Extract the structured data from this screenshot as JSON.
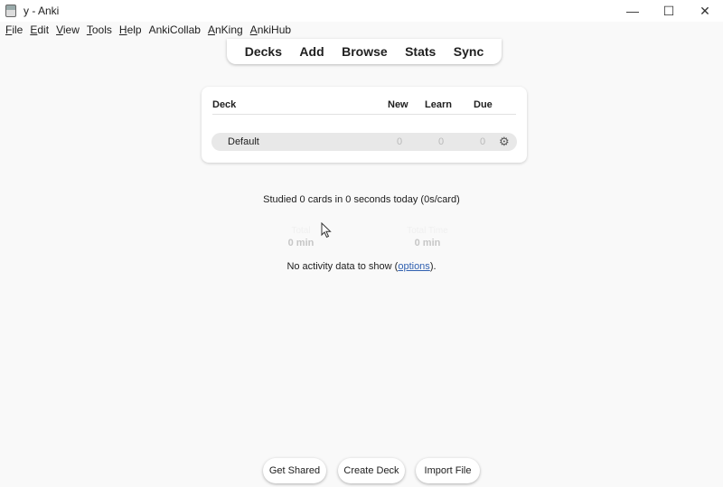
{
  "window": {
    "title": "y - Anki",
    "controls": {
      "minimize": "—",
      "maximize": "☐",
      "close": "✕"
    }
  },
  "menubar": {
    "items": [
      {
        "first": "F",
        "rest": "ile"
      },
      {
        "first": "E",
        "rest": "dit"
      },
      {
        "first": "V",
        "rest": "iew"
      },
      {
        "first": "T",
        "rest": "ools"
      },
      {
        "first": "H",
        "rest": "elp"
      },
      {
        "first": "",
        "rest": "AnkiCollab"
      },
      {
        "first": "A",
        "rest": "nKing"
      },
      {
        "first": "A",
        "rest": "nkiHub"
      }
    ]
  },
  "toolbar": {
    "decks": "Decks",
    "add": "Add",
    "browse": "Browse",
    "stats": "Stats",
    "sync": "Sync"
  },
  "deck_table": {
    "headers": {
      "deck": "Deck",
      "new": "New",
      "learn": "Learn",
      "due": "Due"
    },
    "rows": [
      {
        "name": "Default",
        "new": "0",
        "learn": "0",
        "due": "0"
      }
    ]
  },
  "stats": {
    "studied": "Studied 0 cards in 0 seconds today (0s/card)",
    "left_label": "Total",
    "left_value": "0 min",
    "right_label": "Total Time",
    "right_value": "0 min",
    "no_activity_prefix": "No activity data to show (",
    "no_activity_link": "options",
    "no_activity_suffix": ")."
  },
  "bottom": {
    "get_shared": "Get Shared",
    "create_deck": "Create Deck",
    "import_file": "Import File"
  },
  "icons": {
    "gear": "⚙",
    "app": "anki-app-icon"
  }
}
